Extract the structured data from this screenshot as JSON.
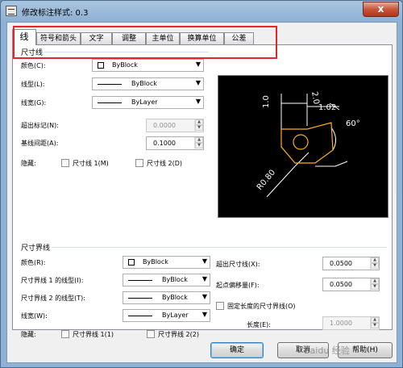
{
  "window": {
    "title": "修改标注样式: 0.3",
    "close_label": "x"
  },
  "tabs": [
    "线",
    "符号和箭头",
    "文字",
    "调整",
    "主单位",
    "换算单位",
    "公差"
  ],
  "dim_lines": {
    "group_title": "尺寸线",
    "color_label": "颜色(C):",
    "color_value": "ByBlock",
    "linetype_label": "线型(L):",
    "linetype_value": "ByBlock",
    "lineweight_label": "线宽(G):",
    "lineweight_value": "ByLayer",
    "extend_label": "超出标记(N):",
    "extend_value": "0.0000",
    "baseline_label": "基线间距(A):",
    "baseline_value": "0.1000",
    "suppress_label": "隐藏:",
    "suppress_1": "尺寸线 1(M)",
    "suppress_2": "尺寸线 2(D)"
  },
  "ext_lines": {
    "group_title": "尺寸界线",
    "color_label": "颜色(R):",
    "color_value": "ByBlock",
    "linetype1_label": "尺寸界线 1 的线型(I):",
    "linetype1_value": "ByBlock",
    "linetype2_label": "尺寸界线 2 的线型(T):",
    "linetype2_value": "ByBlock",
    "lineweight_label": "线宽(W):",
    "lineweight_value": "ByLayer",
    "suppress_label": "隐藏:",
    "suppress_1": "尺寸界线 1(1)",
    "suppress_2": "尺寸界线 2(2)",
    "beyond_label": "超出尺寸线(X):",
    "beyond_value": "0.0500",
    "offset_label": "起点偏移量(F):",
    "offset_value": "0.0500",
    "fixed_label": "固定长度的尺寸界线(O)",
    "length_label": "长度(E):",
    "length_value": "1.0000"
  },
  "preview": {
    "dim_a": "1.0",
    "dim_b": "2.0",
    "dim_c": "1.02",
    "angle": "60°",
    "radius": "R0.80"
  },
  "buttons": {
    "ok": "确定",
    "cancel": "取消",
    "help": "帮助(H)"
  },
  "watermark": "Baidu 经验"
}
